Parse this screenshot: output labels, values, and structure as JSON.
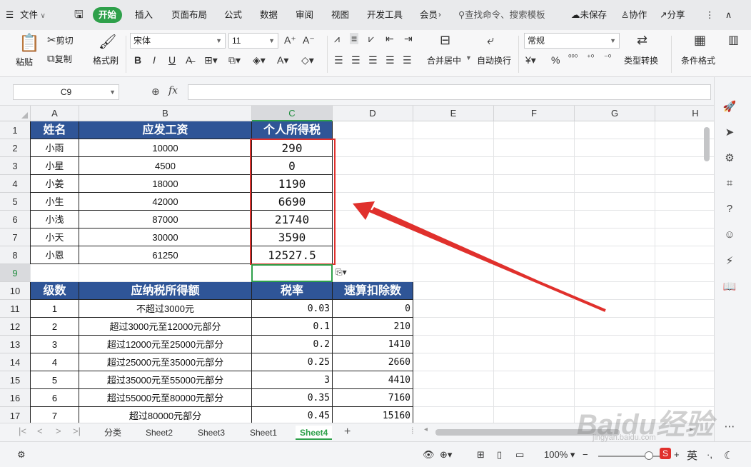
{
  "tabbar": {
    "menu_label": "文件",
    "tabs": [
      "开始",
      "插入",
      "页面布局",
      "公式",
      "数据",
      "审阅",
      "视图",
      "开发工具",
      "会员"
    ],
    "search_label": "查找命令、搜索模板",
    "unsaved_label": "未保存",
    "collab_label": "协作",
    "share_label": "分享"
  },
  "ribbon": {
    "paste_label": "粘贴",
    "cut_label": "剪切",
    "copy_label": "复制",
    "format_painter_label": "格式刷",
    "font_name": "宋体",
    "font_size": "11",
    "merge_label": "合并居中",
    "wrap_label": "自动换行",
    "number_format": "常规",
    "convert_label": "类型转换",
    "cond_format_label": "条件格式"
  },
  "formula_bar": {
    "name_box": "C9",
    "fx_label": "fx",
    "formula": ""
  },
  "grid": {
    "columns": [
      "A",
      "B",
      "C",
      "D",
      "E",
      "F",
      "G",
      "H"
    ],
    "rows": [
      "1",
      "2",
      "3",
      "4",
      "5",
      "6",
      "7",
      "8",
      "9",
      "10",
      "11",
      "12",
      "13",
      "14",
      "15",
      "16",
      "17"
    ],
    "header1": [
      "姓名",
      "应发工资",
      "个人所得税"
    ],
    "employees": [
      {
        "name": "小雨",
        "salary": "10000",
        "tax": "290"
      },
      {
        "name": "小星",
        "salary": "4500",
        "tax": "0"
      },
      {
        "name": "小姜",
        "salary": "18000",
        "tax": "1190"
      },
      {
        "name": "小生",
        "salary": "42000",
        "tax": "6690"
      },
      {
        "name": "小浅",
        "salary": "87000",
        "tax": "21740"
      },
      {
        "name": "小天",
        "salary": "30000",
        "tax": "3590"
      },
      {
        "name": "小恩",
        "salary": "61250",
        "tax": "12527.5"
      }
    ],
    "header2": [
      "级数",
      "应纳税所得额",
      "税率",
      "速算扣除数"
    ],
    "brackets": [
      {
        "level": "1",
        "range": "不超过3000元",
        "rate": "0.03",
        "deduction": "0"
      },
      {
        "level": "2",
        "range": "超过3000元至12000元部分",
        "rate": "0.1",
        "deduction": "210"
      },
      {
        "level": "3",
        "range": "超过12000元至25000元部分",
        "rate": "0.2",
        "deduction": "1410"
      },
      {
        "level": "4",
        "range": "超过25000元至35000元部分",
        "rate": "0.25",
        "deduction": "2660"
      },
      {
        "level": "5",
        "range": "超过35000元至55000元部分",
        "rate": "3",
        "deduction": "4410"
      },
      {
        "level": "6",
        "range": "超过55000元至80000元部分",
        "rate": "0.35",
        "deduction": "7160"
      },
      {
        "level": "7",
        "range": "超过80000元部分",
        "rate": "0.45",
        "deduction": "15160"
      }
    ]
  },
  "sheets": [
    "分类",
    "Sheet2",
    "Sheet3",
    "Sheet1",
    "Sheet4"
  ],
  "active_sheet": "Sheet4",
  "statusbar": {
    "zoom": "100%",
    "ime_label": "英"
  },
  "watermark": {
    "text": "Baidu经验",
    "url": "jingyan.baidu.com"
  },
  "colors": {
    "accent": "#2ea04a",
    "header_fill": "#2f5597",
    "highlight": "#e0302c"
  }
}
